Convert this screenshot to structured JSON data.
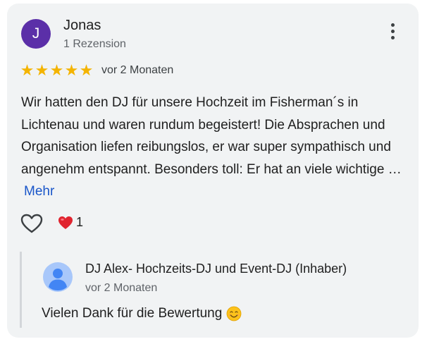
{
  "review": {
    "avatar_initial": "J",
    "author_name": "Jonas",
    "author_meta": "1 Rezension",
    "rating_stars": 5,
    "time": "vor 2 Monaten",
    "text": "Wir hatten den DJ für unsere Hochzeit im Fisherman´s in Lichtenau und waren rundum begeistert! Die Absprachen und Organisation liefen reibungslos, er war super sympathisch und angenehm entspannt. Besonders toll: Er hat an viele wichtige …",
    "more_label": "Mehr",
    "reaction_count": "1",
    "icons": {
      "menu": "more-vertical-icon",
      "like": "heart-outline-icon",
      "reaction": "red-heart-emoji",
      "star": "star-icon"
    }
  },
  "owner_reply": {
    "name": "DJ Alex- Hochzeits-DJ und Event-DJ (Inhaber)",
    "time": "vor 2 Monaten",
    "text": "Vielen Dank für die Bewertung",
    "emoji": "smiling-face-emoji"
  },
  "colors": {
    "card_bg": "#f1f3f4",
    "avatar_bg": "#5b2fa8",
    "star": "#f4b400",
    "link": "#1a56c9",
    "reply_border": "#d3d6da"
  }
}
